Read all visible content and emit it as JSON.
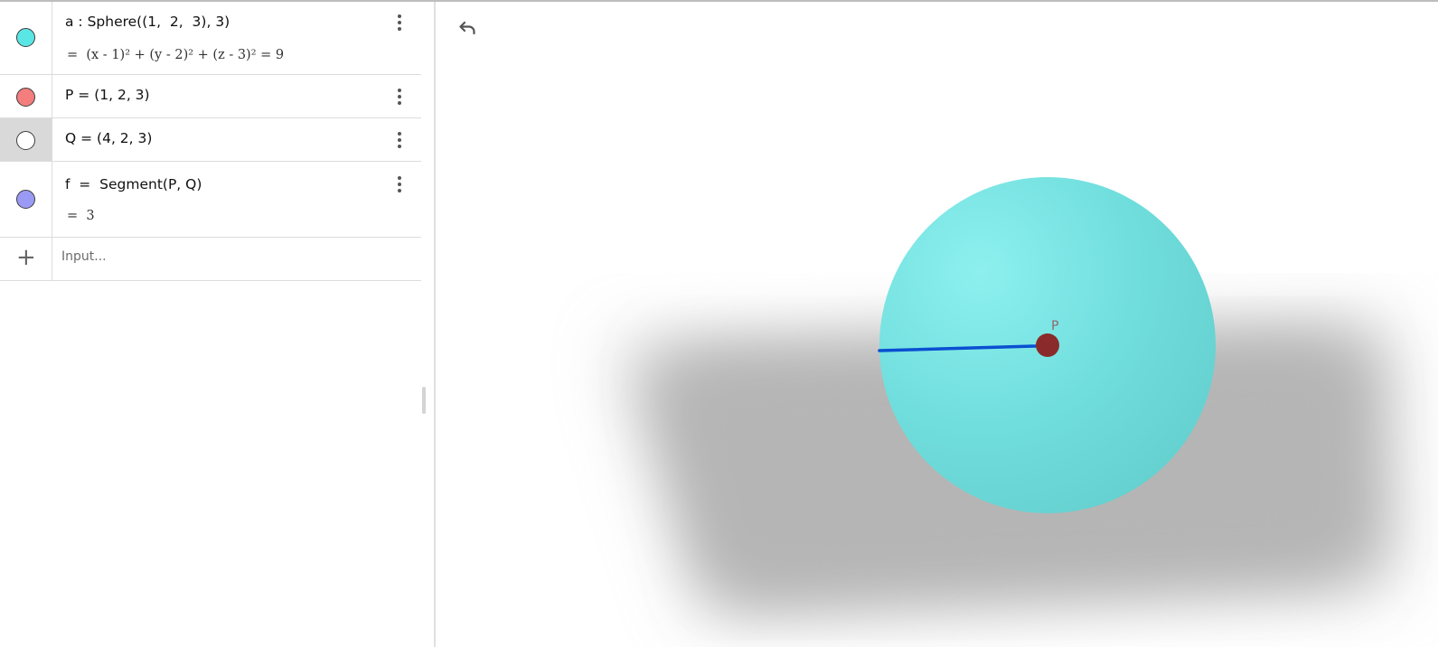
{
  "algebra": {
    "items": [
      {
        "name": "a",
        "definition": "a : Sphere((1,  2,  3), 3)",
        "value": "=  (x - 1)² + (y - 2)² + (z - 3)² = 9",
        "color": "#5be6e6"
      },
      {
        "name": "P",
        "definition": "P = (1, 2, 3)",
        "color": "#f47d7d"
      },
      {
        "name": "Q",
        "definition": "Q = (4, 2, 3)",
        "color": "#ffffff"
      },
      {
        "name": "f",
        "definition": "f  =  Segment(P, Q)",
        "value": "=  3",
        "color": "#9a9af5"
      }
    ],
    "input": {
      "placeholder": "Input...",
      "add_symbol": "+"
    }
  },
  "graphics": {
    "undo_icon": "undo-icon",
    "point_label": "P",
    "sphere_color": "#6fdede",
    "segment_color": "#0a4fd1",
    "point_color": "#8b2a2a",
    "plane_color": "#b5b5b5"
  }
}
